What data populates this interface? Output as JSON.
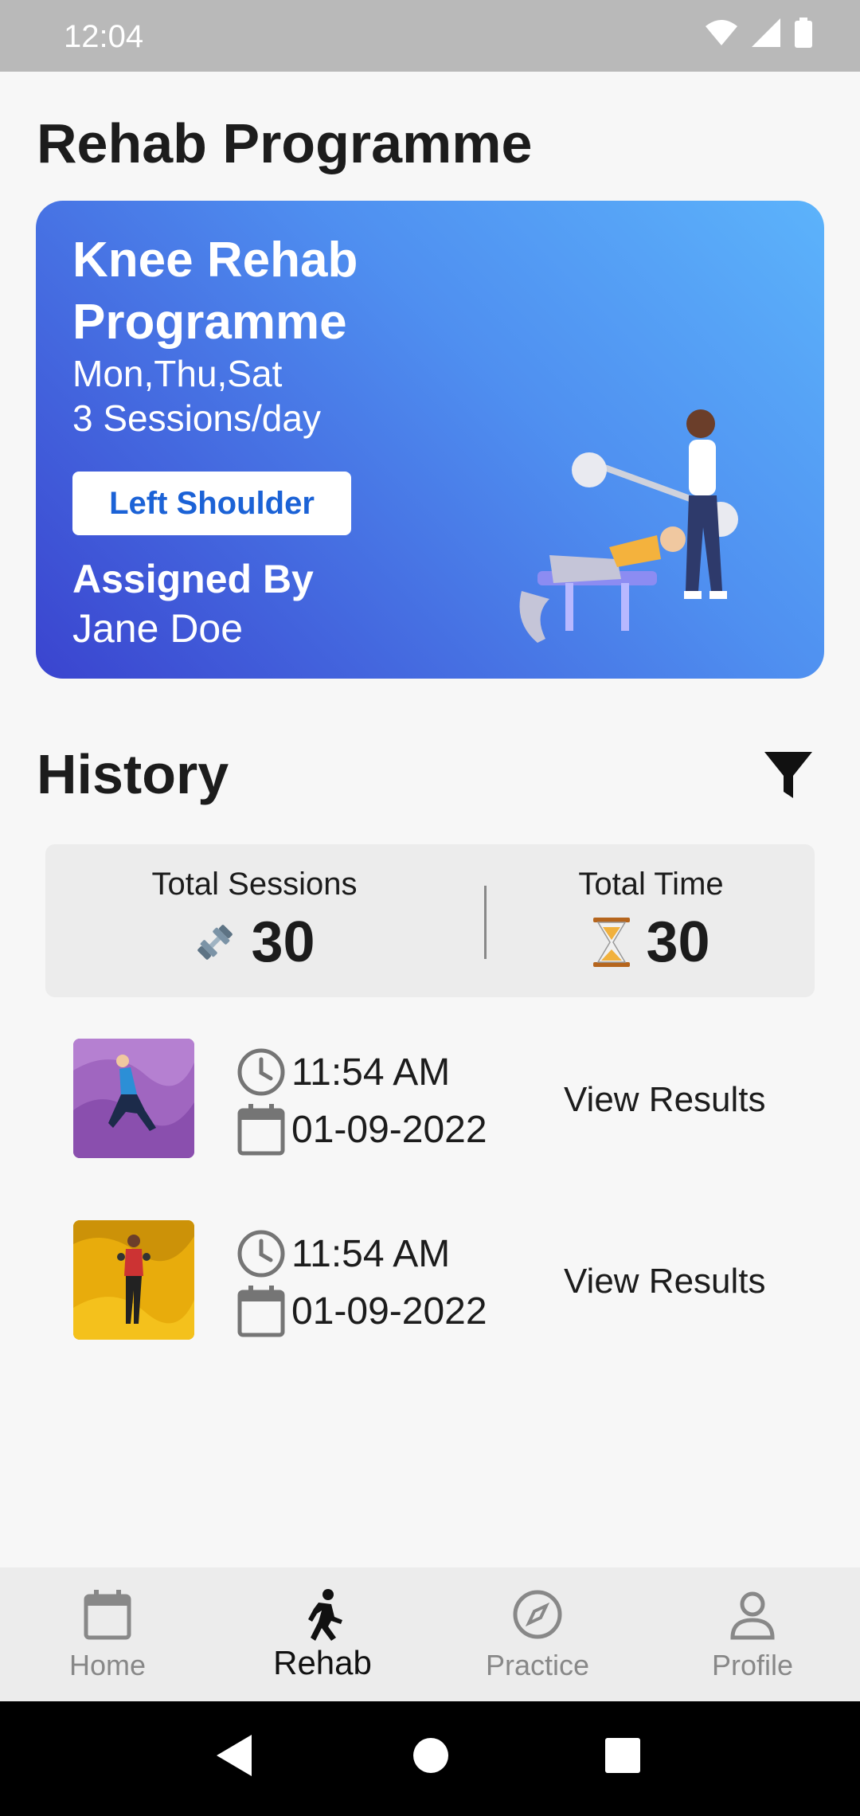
{
  "status_bar": {
    "time": "12:04"
  },
  "page": {
    "title": "Rehab Programme"
  },
  "programme_card": {
    "title": "Knee Rehab Programme",
    "days": "Mon,Thu,Sat",
    "sessions": "3 Sessions/day",
    "body_part_button": "Left Shoulder",
    "assigned_label": "Assigned By",
    "assigned_name": "Jane Doe",
    "gradient": [
      "#5cb3fb",
      "#4f8ff0",
      "#3a44cf"
    ]
  },
  "history": {
    "title": "History",
    "stats": {
      "total_sessions_label": "Total Sessions",
      "total_sessions_value": "30",
      "total_time_label": "Total Time",
      "total_time_value": "30"
    },
    "items": [
      {
        "time": "11:54 AM",
        "date": "01-09-2022",
        "action": "View Results",
        "thumb_color": "#a066c0"
      },
      {
        "time": "11:54 AM",
        "date": "01-09-2022",
        "action": "View Results",
        "thumb_color": "#e8ac0c"
      }
    ]
  },
  "bottom_nav": {
    "items": [
      {
        "label": "Home",
        "icon": "calendar-icon",
        "active": false
      },
      {
        "label": "Rehab",
        "icon": "running-icon",
        "active": true
      },
      {
        "label": "Practice",
        "icon": "compass-icon",
        "active": false
      },
      {
        "label": "Profile",
        "icon": "person-icon",
        "active": false
      }
    ]
  },
  "colors": {
    "accent": "#1b62d6",
    "background": "#f7f7f7",
    "panel": "#ececec"
  }
}
